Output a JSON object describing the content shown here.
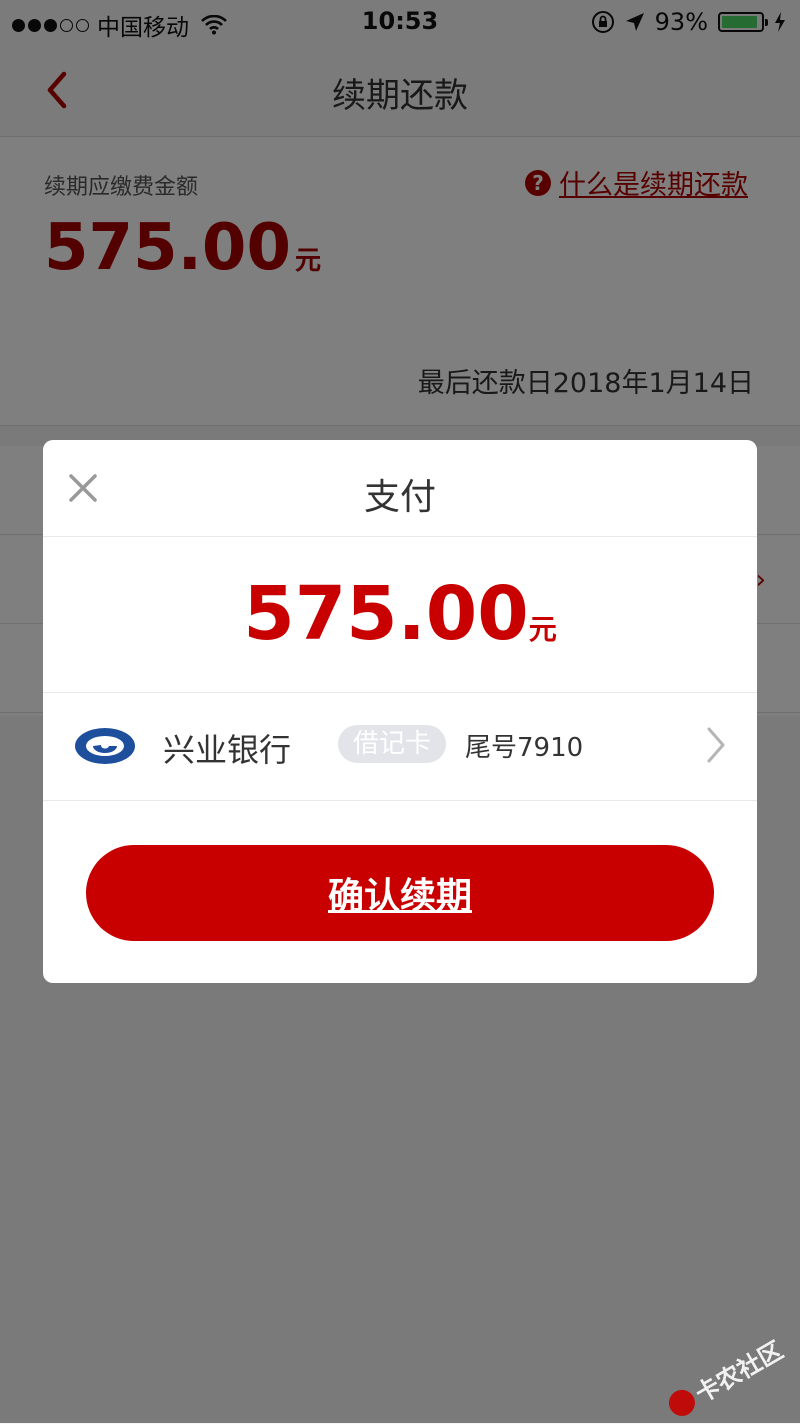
{
  "status_bar": {
    "carrier": "中国移动",
    "time": "10:53",
    "battery": "93%",
    "battery_level": 0.93,
    "signal_bars_filled": 3,
    "signal_bars_total": 5
  },
  "nav": {
    "title": "续期还款",
    "back_icon": "chevron-left-icon"
  },
  "summary": {
    "due_label": "续期应缴费金额",
    "help_link": "什么是续期还款",
    "help_icon": "question-circle-icon",
    "amount": "575.00",
    "unit": "元",
    "deadline": "最后还款日2018年1月14日"
  },
  "dialog": {
    "title": "支付",
    "close_icon": "close-icon",
    "amount": "575.00",
    "unit": "元",
    "card": {
      "bank_name": "兴业银行",
      "card_type": "借记卡",
      "tail": "尾号7910",
      "logo_icon": "bank-logo-icon",
      "chevron_icon": "chevron-right-icon"
    },
    "confirm_label": "确认续期"
  },
  "watermark": {
    "text": "卡农社区"
  },
  "colors": {
    "accent": "#c80000",
    "overlay": "#000000",
    "battery": "#4cd964"
  }
}
